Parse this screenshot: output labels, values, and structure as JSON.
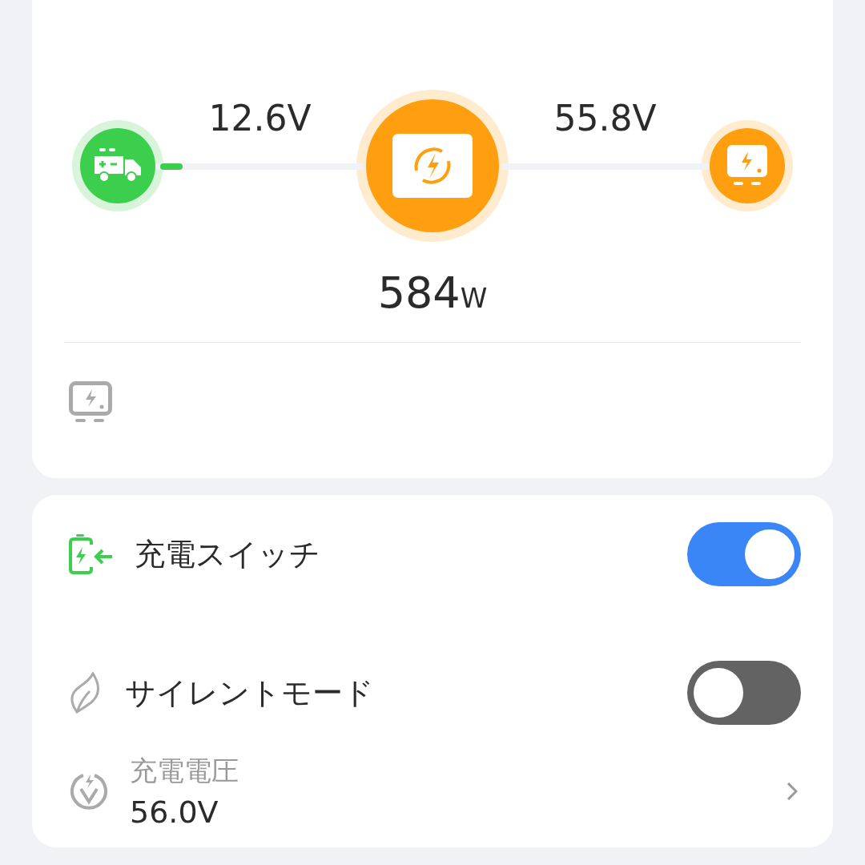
{
  "flow": {
    "nodes": [
      {
        "kind": "vehicle",
        "color": "#3ccf4e"
      },
      {
        "kind": "station",
        "color": "#ff9f10"
      },
      {
        "kind": "charger",
        "color": "#ff9f10"
      }
    ],
    "links": [
      {
        "voltage": "12.6V",
        "flow": true
      },
      {
        "voltage": "55.8V",
        "flow": false
      }
    ],
    "power": {
      "value": "584",
      "unit": "W"
    }
  },
  "device_row": {
    "kind": "charger"
  },
  "settings": [
    {
      "kind": "toggle",
      "label": "充電スイッチ",
      "on": true
    },
    {
      "kind": "toggle",
      "label": "サイレントモード",
      "on": false
    },
    {
      "kind": "value",
      "label": "充電電圧",
      "value": "56.0V"
    }
  ]
}
